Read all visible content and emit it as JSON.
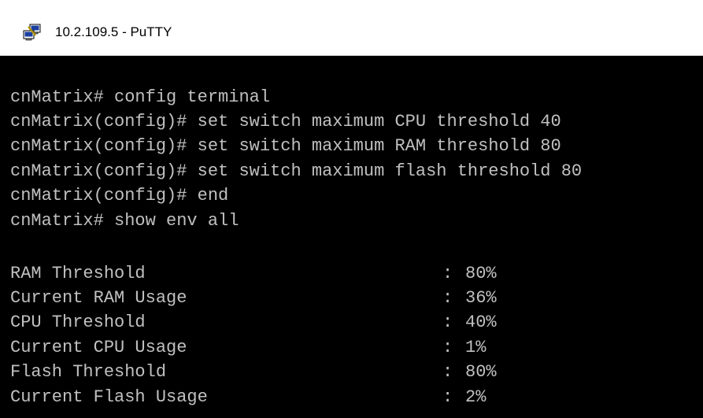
{
  "window": {
    "title": "10.2.109.5 - PuTTY",
    "icon": "putty-icon"
  },
  "colors": {
    "terminal_background": "#000000",
    "terminal_text": "#c0c0c0",
    "titlebar_background": "#ffffff"
  },
  "terminal": {
    "commands": [
      "cnMatrix# config terminal",
      "cnMatrix(config)# set switch maximum CPU threshold 40",
      "cnMatrix(config)# set switch maximum RAM threshold 80",
      "cnMatrix(config)# set switch maximum flash threshold 80",
      "cnMatrix(config)# end",
      "cnMatrix# show env all"
    ],
    "env": [
      {
        "key": "RAM Threshold",
        "sep": ":",
        "value": "80%"
      },
      {
        "key": "Current RAM Usage",
        "sep": ":",
        "value": "36%"
      },
      {
        "key": "CPU Threshold",
        "sep": ":",
        "value": "40%"
      },
      {
        "key": "Current CPU Usage",
        "sep": ":",
        "value": "1%"
      },
      {
        "key": "Flash Threshold",
        "sep": ":",
        "value": "80%"
      },
      {
        "key": "Current Flash Usage",
        "sep": ":",
        "value": "2%"
      }
    ]
  }
}
